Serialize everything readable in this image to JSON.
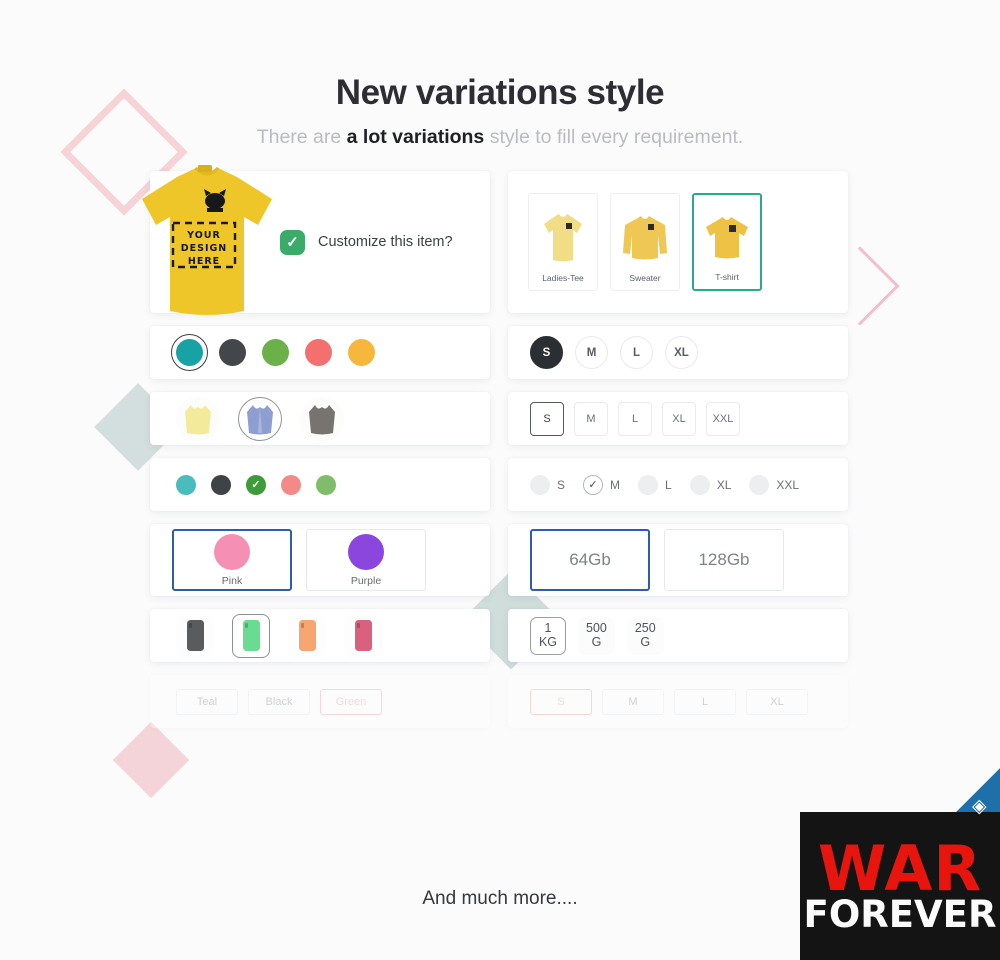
{
  "header": {
    "title": "New variations style",
    "subtitle_before": "There are ",
    "subtitle_strong": "a lot variations",
    "subtitle_after": " style to fill every requirement."
  },
  "hero": {
    "design_line1": "YOUR",
    "design_line2": "DESIGN",
    "design_line3": "HERE",
    "check_glyph": "✓",
    "label": "Customize this item?",
    "shirt_color": "#efc62a"
  },
  "image_variants": {
    "items": [
      {
        "label": "Ladies-Tee",
        "type": "ladies-tee",
        "color": "#f2dd87",
        "selected": false
      },
      {
        "label": "Sweater",
        "type": "sweater",
        "color": "#eec755",
        "selected": false
      },
      {
        "label": "T-shirt",
        "type": "tshirt",
        "color": "#eec245",
        "selected": true
      }
    ],
    "selected_border": "#2aa98c"
  },
  "color_dots_large": {
    "items": [
      {
        "name": "teal",
        "color": "#17a3a3",
        "selected": true
      },
      {
        "name": "dark",
        "color": "#43464a",
        "selected": false
      },
      {
        "name": "green",
        "color": "#6cb04a",
        "selected": false
      },
      {
        "name": "salmon",
        "color": "#f4706f",
        "selected": false
      },
      {
        "name": "orange",
        "color": "#f7b73d",
        "selected": false
      }
    ]
  },
  "size_circles": {
    "items": [
      {
        "label": "S",
        "selected": true
      },
      {
        "label": "M",
        "selected": false
      },
      {
        "label": "L",
        "selected": false
      },
      {
        "label": "XL",
        "selected": false
      }
    ]
  },
  "image_swatches": {
    "items": [
      {
        "name": "yellow-sweater",
        "color": "#f4ea9b",
        "selected": false
      },
      {
        "name": "blue-sweater",
        "color": "#8f9ed0",
        "selected": true
      },
      {
        "name": "gray-sweater",
        "color": "#77746f",
        "selected": false
      }
    ]
  },
  "size_squares": {
    "items": [
      {
        "label": "S",
        "selected": true
      },
      {
        "label": "M",
        "selected": false
      },
      {
        "label": "L",
        "selected": false
      },
      {
        "label": "XL",
        "selected": false
      },
      {
        "label": "XXL",
        "selected": false
      }
    ]
  },
  "color_dots_small": {
    "check_glyph": "✓",
    "items": [
      {
        "name": "teal",
        "color": "#4bbcbc",
        "selected": false
      },
      {
        "name": "dark",
        "color": "#3f4247",
        "selected": false
      },
      {
        "name": "green",
        "color": "#3f9b3a",
        "selected": true
      },
      {
        "name": "salmon",
        "color": "#f48a88",
        "selected": false
      },
      {
        "name": "light-green",
        "color": "#80bd6a",
        "selected": false
      }
    ]
  },
  "size_radios": {
    "check_glyph": "✓",
    "items": [
      {
        "label": "S",
        "selected": false
      },
      {
        "label": "M",
        "selected": true
      },
      {
        "label": "L",
        "selected": false
      },
      {
        "label": "XL",
        "selected": false
      },
      {
        "label": "XXL",
        "selected": false
      }
    ]
  },
  "color_cards": {
    "items": [
      {
        "label": "Pink",
        "color": "#f590b4",
        "selected": true
      },
      {
        "label": "Purple",
        "color": "#8b46dd",
        "selected": false
      }
    ],
    "selected_border": "#2c5fa8"
  },
  "storage_cards": {
    "items": [
      {
        "label": "64Gb",
        "selected": true
      },
      {
        "label": "128Gb",
        "selected": false
      }
    ],
    "selected_border": "#2c5fa8"
  },
  "phone_colors": {
    "items": [
      {
        "name": "gray",
        "color": "#595b5c",
        "selected": false
      },
      {
        "name": "green",
        "color": "#68dd92",
        "selected": true
      },
      {
        "name": "orange",
        "color": "#f7a671",
        "selected": false
      },
      {
        "name": "pink",
        "color": "#d9607f",
        "selected": false
      }
    ]
  },
  "weights": {
    "items": [
      {
        "amount": "1",
        "unit": "KG",
        "selected": true
      },
      {
        "amount": "500",
        "unit": "G",
        "selected": false
      },
      {
        "amount": "250",
        "unit": "G",
        "selected": false
      }
    ]
  },
  "color_names_faded": {
    "items": [
      {
        "label": "Teal",
        "highlight": false
      },
      {
        "label": "Black",
        "highlight": false
      },
      {
        "label": "Green",
        "highlight": true
      }
    ],
    "highlight_color": "#f08a84"
  },
  "size_faded": {
    "items": [
      {
        "label": "S",
        "highlight": true
      },
      {
        "label": "M",
        "highlight": false
      },
      {
        "label": "L",
        "highlight": false
      },
      {
        "label": "XL",
        "highlight": false
      }
    ],
    "highlight_color": "#f08a84"
  },
  "footer": {
    "text": "And much more...."
  },
  "watermark": {
    "line1": "WAR",
    "line2": "FOREVER",
    "red": "#e8150f"
  }
}
